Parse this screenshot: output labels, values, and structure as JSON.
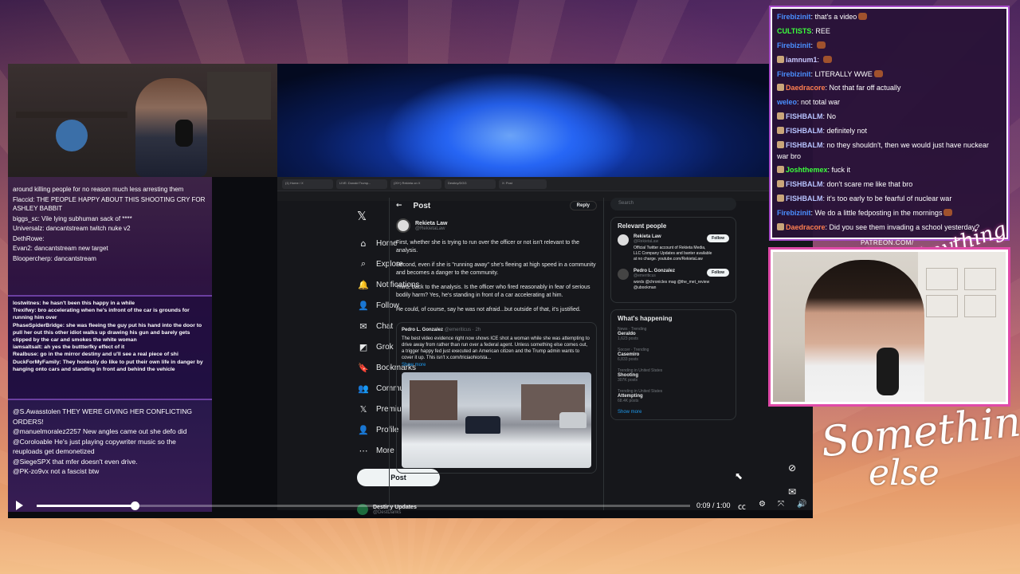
{
  "stream_chat": [
    {
      "user": "Firebizinit",
      "color": "#4a8fff",
      "text": "that's a video",
      "emote": true
    },
    {
      "user": "CULTISTS",
      "color": "#3cff3c",
      "text": "REE",
      "emote": false
    },
    {
      "user": "Firebizinit",
      "color": "#4a8fff",
      "text": "",
      "emote": true
    },
    {
      "user": "iamnum1",
      "color": "#c8c8ff",
      "text": "",
      "emote": true,
      "badge": true
    },
    {
      "user": "Firebizinit",
      "color": "#4a8fff",
      "text": "LITERALLY WWE",
      "emote": true
    },
    {
      "user": "Daedracore",
      "color": "#ff7f50",
      "text": "Not that far off actually",
      "emote": false,
      "badge": true
    },
    {
      "user": "weleo",
      "color": "#4a8fff",
      "text": "not total war",
      "emote": false
    },
    {
      "user": "FISHBALM",
      "color": "#b8c4ff",
      "text": "No",
      "emote": false,
      "badge": true
    },
    {
      "user": "FISHBALM",
      "color": "#b8c4ff",
      "text": "definitely not",
      "emote": false,
      "badge": true
    },
    {
      "user": "FISHBALM",
      "color": "#b8c4ff",
      "text": "no they shouldn't, then we would just have nuckear war bro",
      "emote": false,
      "badge": true
    },
    {
      "user": "Joshthemex",
      "color": "#3cff3c",
      "text": "fuck it",
      "emote": false,
      "badge": true
    },
    {
      "user": "FISHBALM",
      "color": "#b8c4ff",
      "text": "don't scare me like that bro",
      "emote": false,
      "badge": true
    },
    {
      "user": "FISHBALM",
      "color": "#b8c4ff",
      "text": "it's too early to be fearful of nuclear war",
      "emote": false,
      "badge": true
    },
    {
      "user": "Firebizinit",
      "color": "#4a8fff",
      "text": "We do a little fedposting in the mornings",
      "emote": true
    },
    {
      "user": "Daedracore",
      "color": "#ff7f50",
      "text": "Did you see them invading a school yesterday?",
      "emote": false,
      "badge": true
    }
  ],
  "overlay_chat_top": [
    "around killing people for no reason much less arresting them",
    "Flaccid: THE PEOPLE HAPPY ABOUT THIS SHOOTING CRY FOR ASHLEY BABBIT",
    "biggs_sc: Vile lying subhuman sack of ****",
    "Universalz: dancantstream twitch nuke v2",
    "DethRowe:",
    "Evan2: dancantstream new target",
    "Bloopercherp: dancantstream"
  ],
  "overlay_chat_mid": [
    "lostwitnes: he hasn't been this happy in a while",
    "Trexifwy: bro accelerating when he's infront of the car is grounds for running him over",
    "PhaseSpiderBridge: she was fleeing the guy put his hand into the door to pull her out this other idiot walks up drawing his gun and barely gets clipped by the car and smokes the white woman",
    "iamsaltsalt: ah yes the buttterfky effect of it",
    "Realbuse: go in the mirror destiny and u'll see a real piece of shi",
    "DuckForMyFamily: They honestly do like to put their own life in danger by hanging onto cars and standing in front and behind the vehicle"
  ],
  "overlay_chat_bottom": [
    "@S.Awasstolen THEY WERE GIVING HER CONFLICTING ORDERS!",
    "@manuelmoralez2257 New angles came out she defo did",
    "@Coroloable He's just playing copywriter music so the reuploads get demonetized",
    "@SiegeSPX that mfer doesn't even drive.",
    "@PK-zo9vx not a fascist btw"
  ],
  "browser": {
    "tabs": [
      "(1) Home / X",
      "LIVE: Donald Trump...",
      "(20+) Rekieta on X",
      "Destiny/DGG",
      "X: Post"
    ]
  },
  "x_nav": {
    "logo": "𝕏",
    "items": [
      {
        "icon": "⌂",
        "label": "Home"
      },
      {
        "icon": "⌕",
        "label": "Explore"
      },
      {
        "icon": "🔔",
        "label": "Notifications"
      },
      {
        "icon": "👤",
        "label": "Follow"
      },
      {
        "icon": "✉",
        "label": "Chat"
      },
      {
        "icon": "◩",
        "label": "Grok"
      },
      {
        "icon": "🔖",
        "label": "Bookmarks"
      },
      {
        "icon": "👥",
        "label": "Communities"
      },
      {
        "icon": "𝕏",
        "label": "Premium"
      },
      {
        "icon": "👤",
        "label": "Profile"
      },
      {
        "icon": "⋯",
        "label": "More"
      }
    ],
    "post_button": "Post",
    "account_name": "Destiny Updates",
    "account_handle": "@DestDanks"
  },
  "x_post": {
    "header": "Post",
    "reply": "Reply",
    "author_name": "Rekieta Law",
    "author_handle": "@RekietaLaw",
    "paragraphs": [
      "First, whether she is trying to run over the officer or not isn't relevant to the analysis.",
      "Second, even if she is \"running away\" she's fleeing at high speed in a community and becomes a danger to the community.",
      "Third, back to the analysis. Is the officer who fired reasonably in fear of serious bodily harm? Yes, he's standing in front of a car accelerating at him.",
      "He could, of course, say he was not afraid...but outside of that, it's justified."
    ],
    "quote_author": "Pedro L. Gonzalez",
    "quote_handle": "@emeriticus · 2h",
    "quote_text": "The best video evidence right now shows ICE shot a woman while she was attempting to drive away from rather than run over a federal agent. Unless something else comes out, a trigger happy fed just executed an American citizen and the Trump admin wants to cover it up. This isn't x.com/triciaohio/sta...",
    "quote_more": "Show more"
  },
  "x_right": {
    "search_placeholder": "Search",
    "relevant_title": "Relevant people",
    "people": [
      {
        "name": "Rekieta Law",
        "handle": "@RekietaLaw",
        "bio": "Official Twitter account of Rekieta Media, LLC Company Updates and banter available at no charge. youtube.com/RekietaLaw",
        "follow": "Follow"
      },
      {
        "name": "Pedro L. Gonzalez",
        "handle": "@emeriticus",
        "bio": "words @chronicles mag @the_met_review @ubookman",
        "follow": "Follow"
      }
    ],
    "happening_title": "What's happening",
    "trends": [
      {
        "cat": "News · Trending",
        "name": "Geraldo",
        "posts": "1,623 posts"
      },
      {
        "cat": "Soccer · Trending",
        "name": "Casemiro",
        "posts": "6,833 posts"
      },
      {
        "cat": "Trending in United States",
        "name": "Shooting",
        "posts": "307K posts"
      },
      {
        "cat": "Trending in United States",
        "name": "Attempting",
        "posts": "68.4K posts"
      }
    ],
    "show_more": "Show more"
  },
  "player": {
    "time": "0:09 / 1:00",
    "progress": 0.15
  },
  "branding": {
    "patreon": "PATREON.COM/",
    "signature": "Anything else",
    "logo_line1": "Something",
    "logo_line2": "else"
  }
}
